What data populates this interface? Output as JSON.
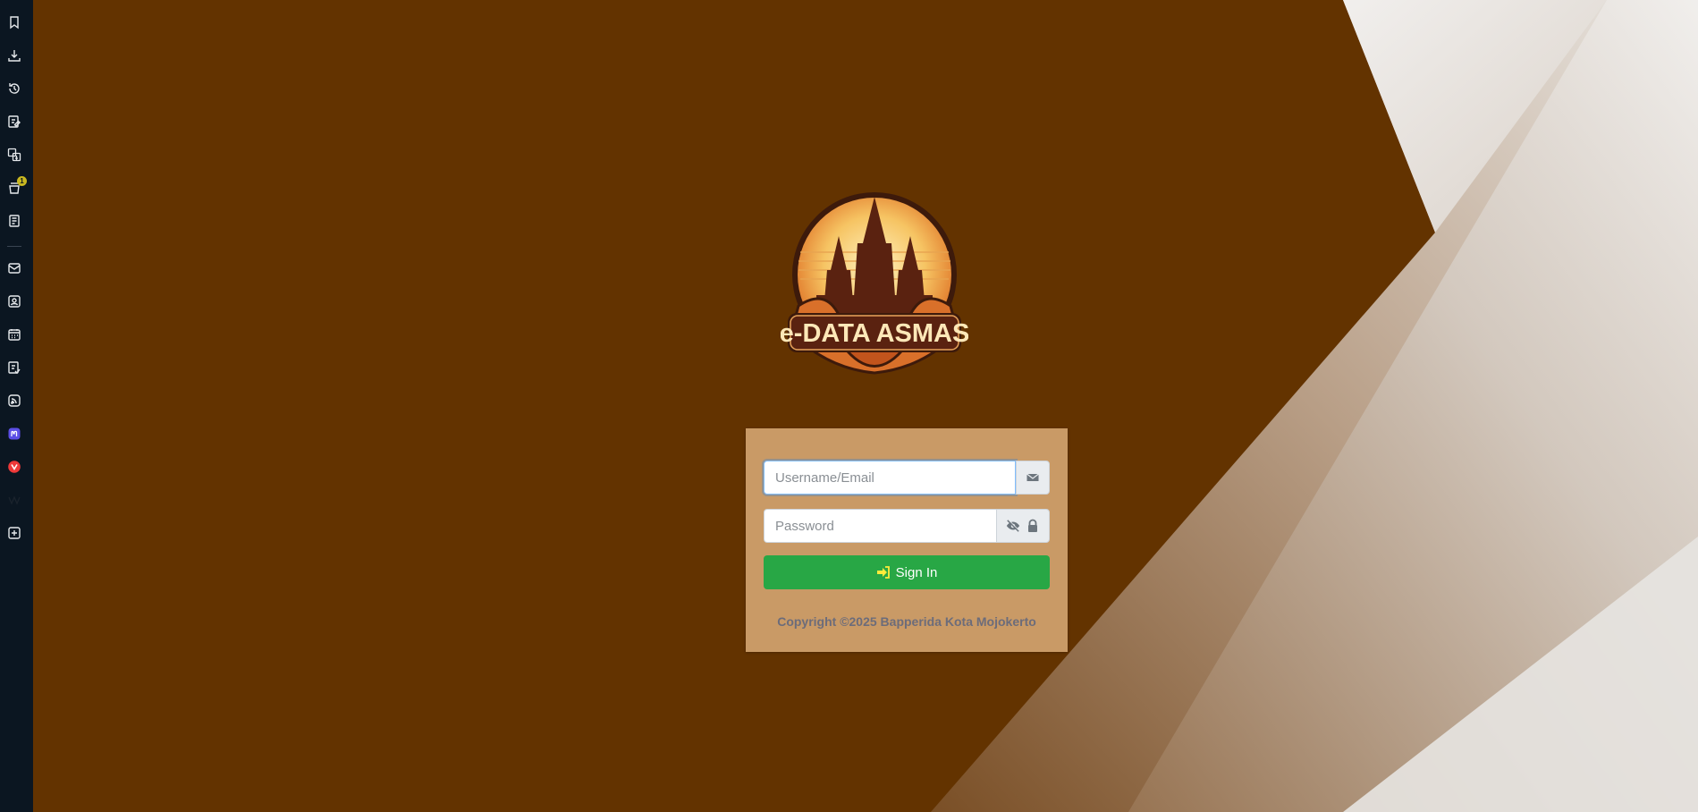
{
  "sidebar": {
    "items": [
      {
        "icon": "bookmark-icon"
      },
      {
        "icon": "download-icon"
      },
      {
        "icon": "history-icon"
      },
      {
        "icon": "notes-icon"
      },
      {
        "icon": "translate-icon"
      },
      {
        "icon": "tab-stack-icon",
        "badge": "1"
      },
      {
        "icon": "reading-list-icon"
      },
      {
        "icon": "mail-icon"
      },
      {
        "icon": "contacts-icon"
      },
      {
        "icon": "calendar-icon"
      },
      {
        "icon": "tasks-icon"
      },
      {
        "icon": "feed-icon"
      },
      {
        "icon": "mastodon-icon"
      },
      {
        "icon": "vivaldi-icon"
      },
      {
        "icon": "wikipedia-icon"
      },
      {
        "icon": "add-panel-icon"
      }
    ]
  },
  "logo": {
    "text": "e-DATA ASMAS"
  },
  "login": {
    "username_placeholder": "Username/Email",
    "password_placeholder": "Password",
    "username_icon": "envelope-icon",
    "password_icons": [
      "eye-slash-icon",
      "lock-icon"
    ],
    "signin_label": "Sign In",
    "signin_icon": "sign-in-icon",
    "copyright": "Copyright ©2025 Bapperida Kota Mojokerto"
  },
  "colors": {
    "background": "#633300",
    "card": "#c99a66",
    "signin_button": "#28a745",
    "signin_icon": "#ffeb3b",
    "sidebar": "#0b1621"
  }
}
